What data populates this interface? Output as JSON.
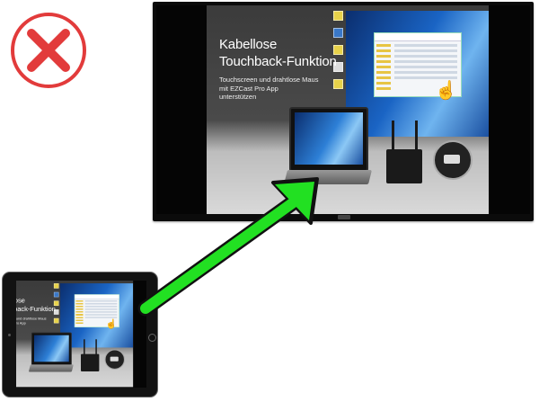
{
  "badge": {
    "icon": "cross-circle-icon",
    "color": "#e23b3b"
  },
  "slide": {
    "title": "Kabellose\nTouchback-Funktion",
    "subtitle": "Touchscreen und drahtlose Maus\nmit EZCast Pro App\nunterstützen"
  },
  "arrow": {
    "icon": "arrow-icon",
    "color": "#22e022"
  }
}
